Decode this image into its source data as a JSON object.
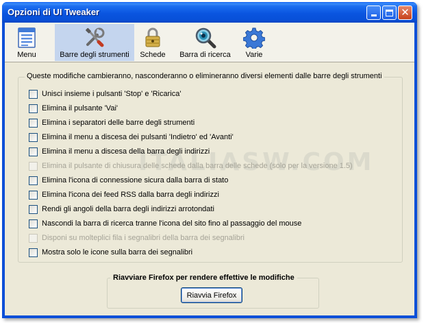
{
  "window": {
    "title": "Opzioni di UI Tweaker"
  },
  "toolbar": {
    "items": [
      {
        "label": "Menu",
        "icon": "menu-list-icon",
        "selected": false
      },
      {
        "label": "Barre degli strumenti",
        "icon": "tools-icon",
        "selected": true
      },
      {
        "label": "Schede",
        "icon": "lock-tabs-icon",
        "selected": false
      },
      {
        "label": "Barra di ricerca",
        "icon": "magnifier-icon",
        "selected": false
      },
      {
        "label": "Varie",
        "icon": "gear-icon",
        "selected": false
      }
    ]
  },
  "group": {
    "legend": "Queste modifiche cambieranno, nasconderanno o elimineranno diversi elementi dalle barre degli strumenti",
    "options": [
      {
        "label": "Unisci insieme i pulsanti 'Stop' e 'Ricarica'",
        "checked": false,
        "enabled": true
      },
      {
        "label": "Elimina il pulsante 'Vai'",
        "checked": false,
        "enabled": true
      },
      {
        "label": "Elimina i separatori delle barre degli strumenti",
        "checked": false,
        "enabled": true
      },
      {
        "label": "Elimina il menu a discesa dei pulsanti 'Indietro' ed 'Avanti'",
        "checked": false,
        "enabled": true
      },
      {
        "label": "Elimina il menu a discesa della barra degli indirizzi",
        "checked": false,
        "enabled": true
      },
      {
        "label": "Elimina il pulsante di chiusura delle schede dalla barra delle schede (solo per la versione 1.5)",
        "checked": false,
        "enabled": false
      },
      {
        "label": "Elimina l'icona di connessione sicura dalla barra di stato",
        "checked": false,
        "enabled": true
      },
      {
        "label": "Elimina l'icona dei feed RSS dalla barra degli indirizzi",
        "checked": false,
        "enabled": true
      },
      {
        "label": "Rendi gli angoli della barra degli indirizzi arrotondati",
        "checked": false,
        "enabled": true
      },
      {
        "label": "Nascondi la barra di ricerca tranne l'icona del sito fino al passaggio del mouse",
        "checked": false,
        "enabled": true
      },
      {
        "label": "Disponi su molteplici fila i segnalibri della barra dei segnalibri",
        "checked": false,
        "enabled": false
      },
      {
        "label": "Mostra solo le icone sulla barra dei segnalibri",
        "checked": false,
        "enabled": true
      }
    ]
  },
  "restart": {
    "legend": "Riavviare Firefox per rendere effettive le modifiche",
    "button_label": "Riavvia Firefox"
  },
  "watermark": {
    "text": "ITALIASW.COM"
  },
  "colors": {
    "titlebar": "#0a55e0",
    "dialog_bg": "#ece9d8",
    "selected_tab": "#c4d5ee"
  }
}
